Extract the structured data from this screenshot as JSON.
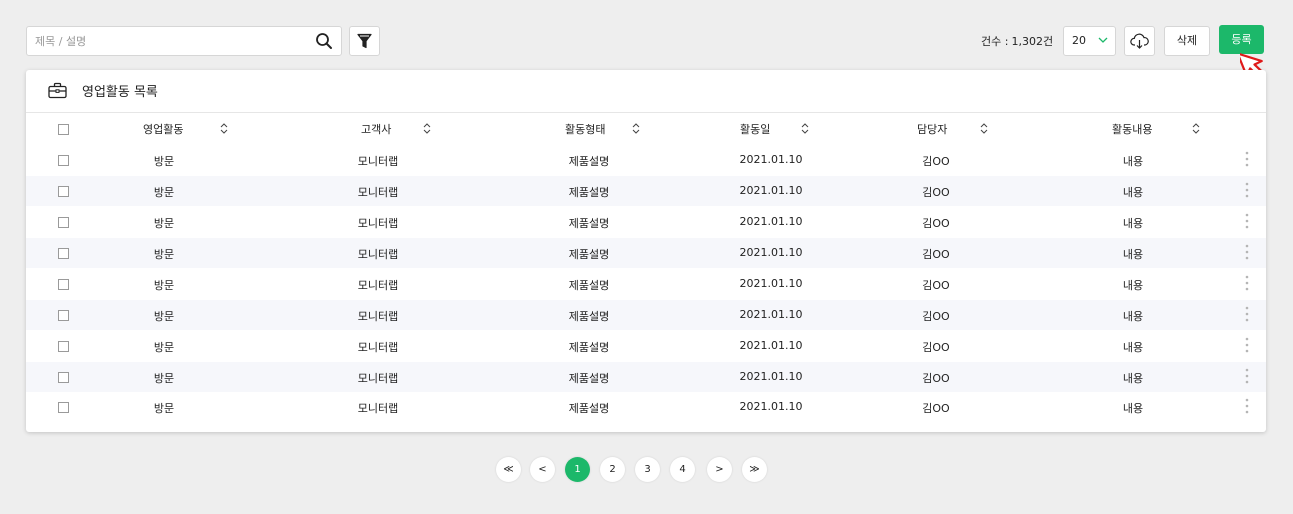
{
  "search": {
    "placeholder": "제목 / 설명",
    "value": ""
  },
  "toolbar": {
    "count_label": "건수 :",
    "count_value": "1,302건",
    "page_size": "20",
    "delete_label": "삭제",
    "register_label": "등록"
  },
  "card": {
    "title": "영업활동 목록"
  },
  "table": {
    "headers": [
      "영업활동",
      "고객사",
      "활동형태",
      "활동일",
      "담당자",
      "활동내용"
    ],
    "rows": [
      [
        "방문",
        "모니터랩",
        "제품설명",
        "2021.01.10",
        "김OO",
        "내용"
      ],
      [
        "방문",
        "모니터랩",
        "제품설명",
        "2021.01.10",
        "김OO",
        "내용"
      ],
      [
        "방문",
        "모니터랩",
        "제품설명",
        "2021.01.10",
        "김OO",
        "내용"
      ],
      [
        "방문",
        "모니터랩",
        "제품설명",
        "2021.01.10",
        "김OO",
        "내용"
      ],
      [
        "방문",
        "모니터랩",
        "제품설명",
        "2021.01.10",
        "김OO",
        "내용"
      ],
      [
        "방문",
        "모니터랩",
        "제품설명",
        "2021.01.10",
        "김OO",
        "내용"
      ],
      [
        "방문",
        "모니터랩",
        "제품설명",
        "2021.01.10",
        "김OO",
        "내용"
      ],
      [
        "방문",
        "모니터랩",
        "제품설명",
        "2021.01.10",
        "김OO",
        "내용"
      ],
      [
        "방문",
        "모니터랩",
        "제품설명",
        "2021.01.10",
        "김OO",
        "내용"
      ]
    ]
  },
  "pagination": {
    "first": "≪",
    "prev": "<",
    "next": ">",
    "last": "≫",
    "pages": [
      "1",
      "2",
      "3",
      "4"
    ],
    "current": "1"
  },
  "colors": {
    "accent": "#1cb86a",
    "row_alt": "#f6f7fb",
    "background": "#eeeeee"
  },
  "icons": {
    "search": "search-icon",
    "filter": "filter-icon",
    "download": "cloud-download-icon",
    "chevron": "chevron-down-icon",
    "briefcase": "briefcase-icon",
    "sort": "sort-icon",
    "more": "more-vertical-icon",
    "cursor": "cursor-arrow-icon"
  }
}
